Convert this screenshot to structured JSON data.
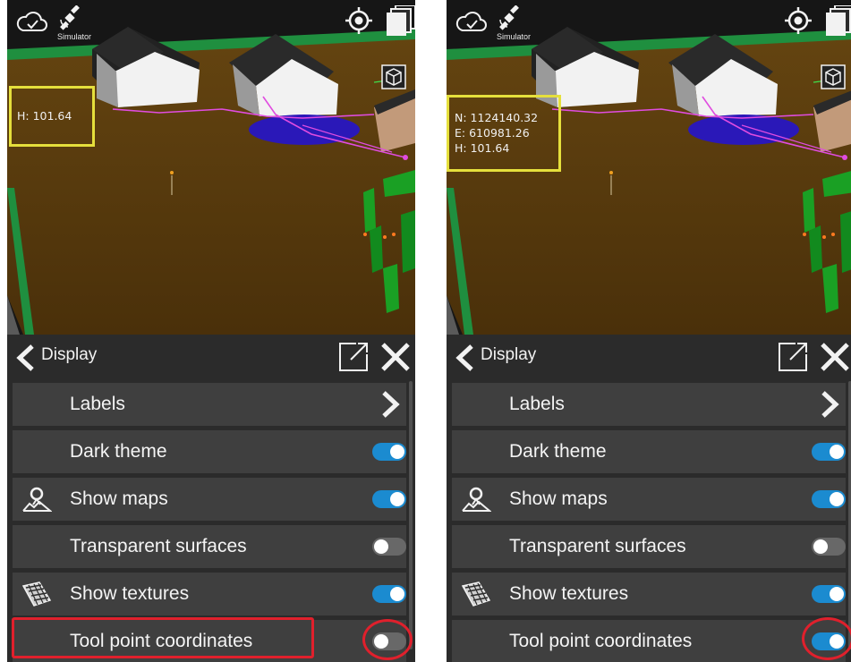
{
  "panels": [
    {
      "header": {
        "title": "Display"
      },
      "status": {
        "simulator_label": "Simulator"
      },
      "coordinates": {
        "lines": [
          "H: 101.64"
        ]
      },
      "menu": {
        "items": [
          {
            "label": "Labels",
            "control": "chevron"
          },
          {
            "label": "Dark theme",
            "control": "toggle",
            "state": "on"
          },
          {
            "label": "Show maps",
            "control": "toggle",
            "state": "on",
            "icon": "map-pin-icon"
          },
          {
            "label": "Transparent surfaces",
            "control": "toggle",
            "state": "off"
          },
          {
            "label": "Show textures",
            "control": "toggle",
            "state": "on",
            "icon": "texture-icon"
          },
          {
            "label": "Tool point coordinates",
            "control": "toggle",
            "state": "off",
            "highlighted": true
          }
        ]
      }
    },
    {
      "header": {
        "title": "Display"
      },
      "status": {
        "simulator_label": "Simulator"
      },
      "coordinates": {
        "lines": [
          "N: 1124140.32",
          "E: 610981.26",
          "H: 101.64"
        ]
      },
      "menu": {
        "items": [
          {
            "label": "Labels",
            "control": "chevron"
          },
          {
            "label": "Dark theme",
            "control": "toggle",
            "state": "on"
          },
          {
            "label": "Show maps",
            "control": "toggle",
            "state": "on",
            "icon": "map-pin-icon"
          },
          {
            "label": "Transparent surfaces",
            "control": "toggle",
            "state": "off"
          },
          {
            "label": "Show textures",
            "control": "toggle",
            "state": "on",
            "icon": "texture-icon"
          },
          {
            "label": "Tool point coordinates",
            "control": "toggle",
            "state": "on",
            "highlighted": true
          }
        ]
      }
    }
  ],
  "colors": {
    "toggle_on": "#1b8bd0",
    "toggle_off": "#686868",
    "highlight": "#e0202c",
    "coord_box": "#e5df3c",
    "ground": "#5e3d0e",
    "ground_border": "#1f8f3f"
  }
}
